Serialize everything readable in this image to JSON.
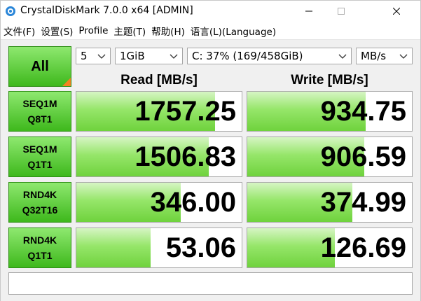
{
  "window": {
    "title": "CrystalDiskMark 7.0.0 x64 [ADMIN]"
  },
  "menu": [
    "文件(F)",
    "设置(S)",
    "Profile",
    "主题(T)",
    "帮助(H)",
    "语言(L)(Language)"
  ],
  "controls": {
    "all_label": "All",
    "test_count": "5",
    "test_size": "1GiB",
    "drive": "C: 37% (169/458GiB)",
    "unit": "MB/s"
  },
  "headers": {
    "read": "Read [MB/s]",
    "write": "Write [MB/s]"
  },
  "rows": [
    {
      "line1": "SEQ1M",
      "line2": "Q8T1",
      "read": "1757.25",
      "write": "934.75",
      "read_fill": 0.84,
      "write_fill": 0.72
    },
    {
      "line1": "SEQ1M",
      "line2": "Q1T1",
      "read": "1506.83",
      "write": "906.59",
      "read_fill": 0.8,
      "write_fill": 0.71
    },
    {
      "line1": "RND4K",
      "line2": "Q32T16",
      "read": "346.00",
      "write": "374.99",
      "read_fill": 0.63,
      "write_fill": 0.64
    },
    {
      "line1": "RND4K",
      "line2": "Q1T1",
      "read": "53.06",
      "write": "126.69",
      "read_fill": 0.45,
      "write_fill": 0.53
    }
  ],
  "comment": "",
  "colors": {
    "button_green": "#3eb81c",
    "bar_green": "#6fd23d",
    "accent_orange": "#f58220"
  }
}
